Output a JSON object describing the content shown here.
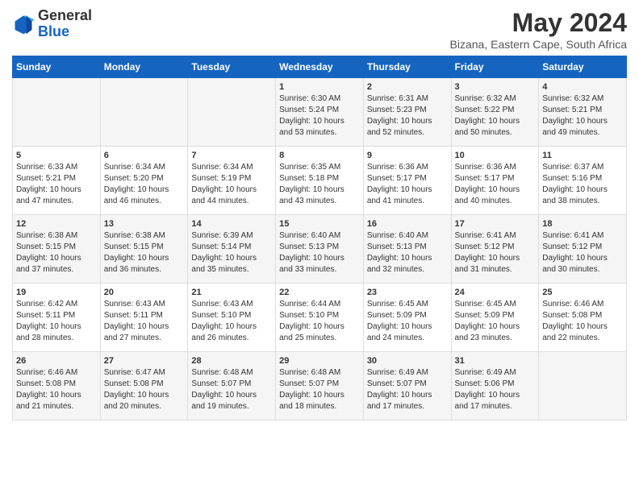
{
  "header": {
    "logo_general": "General",
    "logo_blue": "Blue",
    "month": "May 2024",
    "location": "Bizana, Eastern Cape, South Africa"
  },
  "days_of_week": [
    "Sunday",
    "Monday",
    "Tuesday",
    "Wednesday",
    "Thursday",
    "Friday",
    "Saturday"
  ],
  "weeks": [
    {
      "days": [
        {
          "num": "",
          "info": ""
        },
        {
          "num": "",
          "info": ""
        },
        {
          "num": "",
          "info": ""
        },
        {
          "num": "1",
          "info": "Sunrise: 6:30 AM\nSunset: 5:24 PM\nDaylight: 10 hours\nand 53 minutes."
        },
        {
          "num": "2",
          "info": "Sunrise: 6:31 AM\nSunset: 5:23 PM\nDaylight: 10 hours\nand 52 minutes."
        },
        {
          "num": "3",
          "info": "Sunrise: 6:32 AM\nSunset: 5:22 PM\nDaylight: 10 hours\nand 50 minutes."
        },
        {
          "num": "4",
          "info": "Sunrise: 6:32 AM\nSunset: 5:21 PM\nDaylight: 10 hours\nand 49 minutes."
        }
      ]
    },
    {
      "days": [
        {
          "num": "5",
          "info": "Sunrise: 6:33 AM\nSunset: 5:21 PM\nDaylight: 10 hours\nand 47 minutes."
        },
        {
          "num": "6",
          "info": "Sunrise: 6:34 AM\nSunset: 5:20 PM\nDaylight: 10 hours\nand 46 minutes."
        },
        {
          "num": "7",
          "info": "Sunrise: 6:34 AM\nSunset: 5:19 PM\nDaylight: 10 hours\nand 44 minutes."
        },
        {
          "num": "8",
          "info": "Sunrise: 6:35 AM\nSunset: 5:18 PM\nDaylight: 10 hours\nand 43 minutes."
        },
        {
          "num": "9",
          "info": "Sunrise: 6:36 AM\nSunset: 5:17 PM\nDaylight: 10 hours\nand 41 minutes."
        },
        {
          "num": "10",
          "info": "Sunrise: 6:36 AM\nSunset: 5:17 PM\nDaylight: 10 hours\nand 40 minutes."
        },
        {
          "num": "11",
          "info": "Sunrise: 6:37 AM\nSunset: 5:16 PM\nDaylight: 10 hours\nand 38 minutes."
        }
      ]
    },
    {
      "days": [
        {
          "num": "12",
          "info": "Sunrise: 6:38 AM\nSunset: 5:15 PM\nDaylight: 10 hours\nand 37 minutes."
        },
        {
          "num": "13",
          "info": "Sunrise: 6:38 AM\nSunset: 5:15 PM\nDaylight: 10 hours\nand 36 minutes."
        },
        {
          "num": "14",
          "info": "Sunrise: 6:39 AM\nSunset: 5:14 PM\nDaylight: 10 hours\nand 35 minutes."
        },
        {
          "num": "15",
          "info": "Sunrise: 6:40 AM\nSunset: 5:13 PM\nDaylight: 10 hours\nand 33 minutes."
        },
        {
          "num": "16",
          "info": "Sunrise: 6:40 AM\nSunset: 5:13 PM\nDaylight: 10 hours\nand 32 minutes."
        },
        {
          "num": "17",
          "info": "Sunrise: 6:41 AM\nSunset: 5:12 PM\nDaylight: 10 hours\nand 31 minutes."
        },
        {
          "num": "18",
          "info": "Sunrise: 6:41 AM\nSunset: 5:12 PM\nDaylight: 10 hours\nand 30 minutes."
        }
      ]
    },
    {
      "days": [
        {
          "num": "19",
          "info": "Sunrise: 6:42 AM\nSunset: 5:11 PM\nDaylight: 10 hours\nand 28 minutes."
        },
        {
          "num": "20",
          "info": "Sunrise: 6:43 AM\nSunset: 5:11 PM\nDaylight: 10 hours\nand 27 minutes."
        },
        {
          "num": "21",
          "info": "Sunrise: 6:43 AM\nSunset: 5:10 PM\nDaylight: 10 hours\nand 26 minutes."
        },
        {
          "num": "22",
          "info": "Sunrise: 6:44 AM\nSunset: 5:10 PM\nDaylight: 10 hours\nand 25 minutes."
        },
        {
          "num": "23",
          "info": "Sunrise: 6:45 AM\nSunset: 5:09 PM\nDaylight: 10 hours\nand 24 minutes."
        },
        {
          "num": "24",
          "info": "Sunrise: 6:45 AM\nSunset: 5:09 PM\nDaylight: 10 hours\nand 23 minutes."
        },
        {
          "num": "25",
          "info": "Sunrise: 6:46 AM\nSunset: 5:08 PM\nDaylight: 10 hours\nand 22 minutes."
        }
      ]
    },
    {
      "days": [
        {
          "num": "26",
          "info": "Sunrise: 6:46 AM\nSunset: 5:08 PM\nDaylight: 10 hours\nand 21 minutes."
        },
        {
          "num": "27",
          "info": "Sunrise: 6:47 AM\nSunset: 5:08 PM\nDaylight: 10 hours\nand 20 minutes."
        },
        {
          "num": "28",
          "info": "Sunrise: 6:48 AM\nSunset: 5:07 PM\nDaylight: 10 hours\nand 19 minutes."
        },
        {
          "num": "29",
          "info": "Sunrise: 6:48 AM\nSunset: 5:07 PM\nDaylight: 10 hours\nand 18 minutes."
        },
        {
          "num": "30",
          "info": "Sunrise: 6:49 AM\nSunset: 5:07 PM\nDaylight: 10 hours\nand 17 minutes."
        },
        {
          "num": "31",
          "info": "Sunrise: 6:49 AM\nSunset: 5:06 PM\nDaylight: 10 hours\nand 17 minutes."
        },
        {
          "num": "",
          "info": ""
        }
      ]
    }
  ]
}
